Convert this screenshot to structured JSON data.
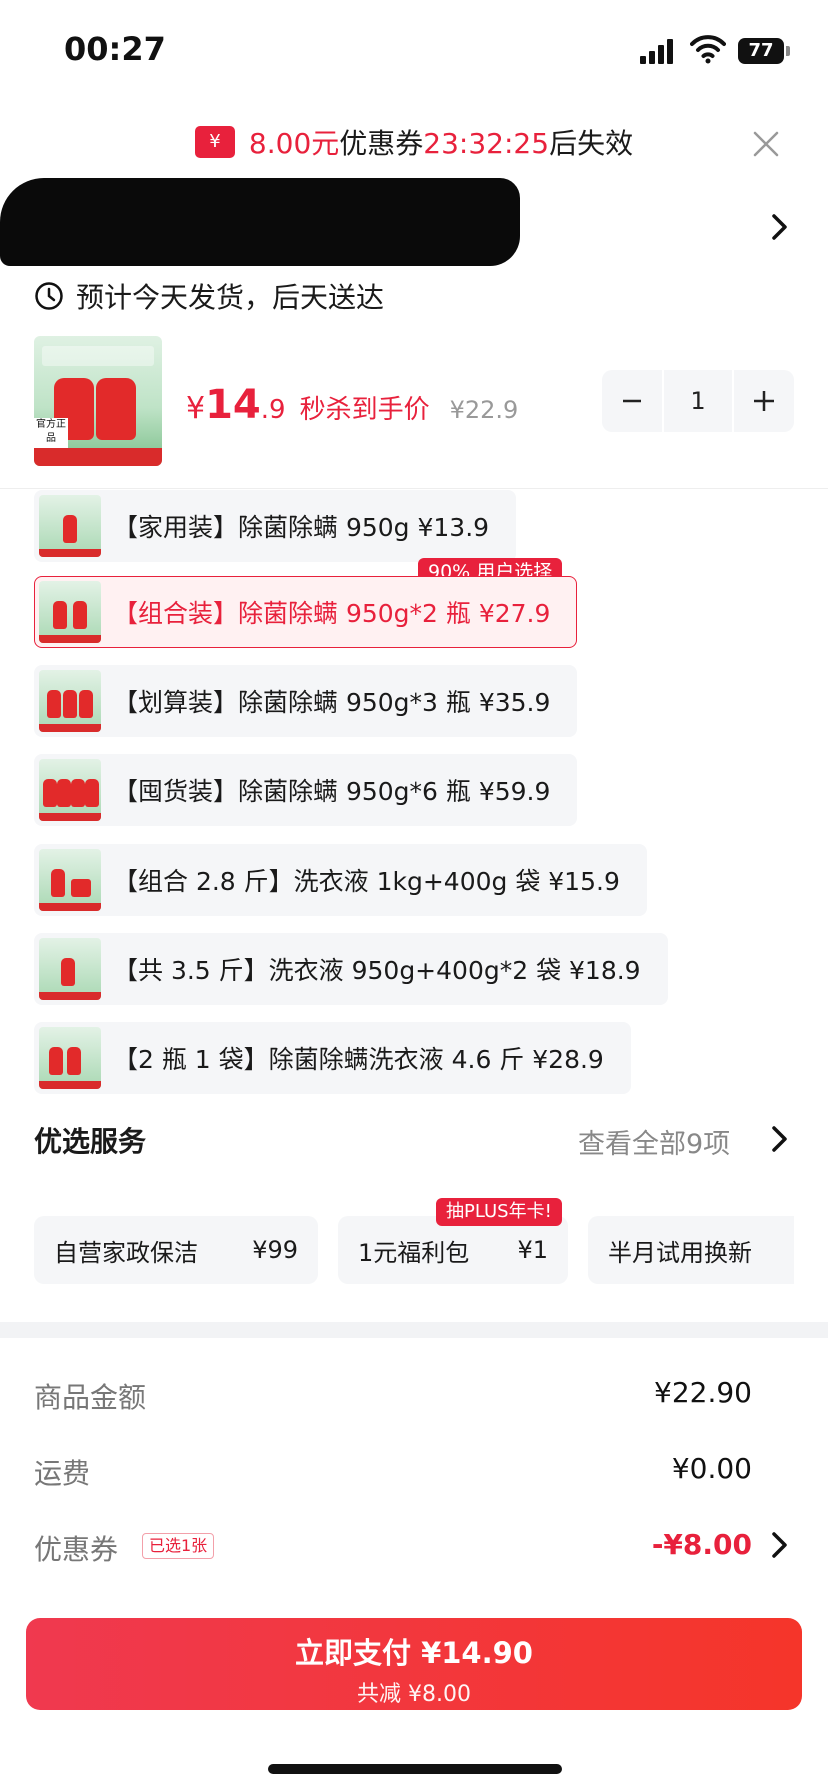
{
  "status_bar": {
    "time": "00:27",
    "battery": "77"
  },
  "coupon_timer": {
    "amount": "8.00元",
    "label": "优惠券",
    "countdown": "23:32:25",
    "suffix": "后失效"
  },
  "delivery": {
    "text": "预计今天发货，后天送达"
  },
  "product": {
    "image_caption": "官方正品",
    "price_symbol": "¥",
    "price_int": "14",
    "price_dec": ".9",
    "price_tag": "秒杀到手价",
    "original_price": "¥22.9",
    "quantity": "1"
  },
  "variants": [
    {
      "label": "【家用装】除菌除螨 950g  ¥13.9",
      "selected": false
    },
    {
      "label": "【组合装】除菌除螨 950g*2 瓶  ¥27.9",
      "selected": true,
      "badge": "90% 用户选择"
    },
    {
      "label": "【划算装】除菌除螨 950g*3 瓶  ¥35.9",
      "selected": false
    },
    {
      "label": "【囤货装】除菌除螨 950g*6 瓶  ¥59.9",
      "selected": false
    },
    {
      "label": "【组合 2.8 斤】洗衣液 1kg+400g 袋  ¥15.9",
      "selected": false
    },
    {
      "label": "【共 3.5 斤】洗衣液 950g+400g*2 袋  ¥18.9",
      "selected": false
    },
    {
      "label": "【2 瓶 1 袋】除菌除螨洗衣液 4.6 斤  ¥28.9",
      "selected": false
    }
  ],
  "services": {
    "title": "优选服务",
    "view_all": "查看全部9项",
    "items": [
      {
        "name": "自营家政保洁",
        "price": "¥99"
      },
      {
        "name": "1元福利包",
        "price": "¥1",
        "badge": "抽PLUS年卡!"
      },
      {
        "name": "半月试用换新",
        "price": ""
      }
    ]
  },
  "summary": {
    "goods_label": "商品金额",
    "goods_value": "¥22.90",
    "shipping_label": "运费",
    "shipping_value": "¥0.00",
    "coupon_label": "优惠券",
    "coupon_chosen": "已选1张",
    "coupon_value": "-¥8.00"
  },
  "pay_button": {
    "main": "立即支付 ¥14.90",
    "sub": "共减 ¥8.00"
  },
  "colors": {
    "accent": "#e8213c",
    "muted": "#888888",
    "chip_bg": "#f5f6f8"
  }
}
